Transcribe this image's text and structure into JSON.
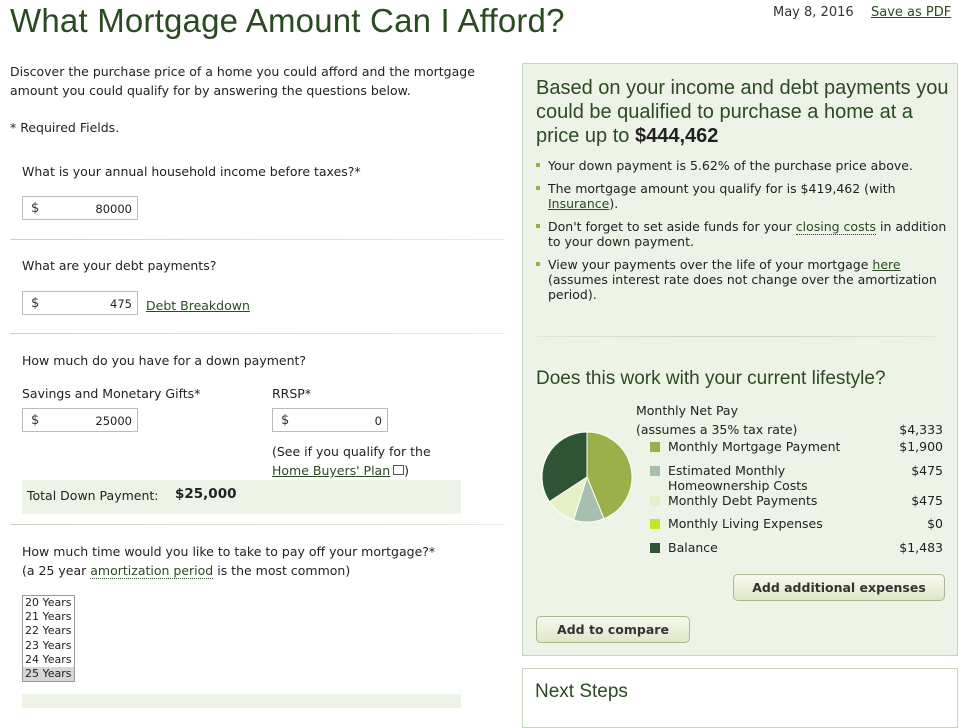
{
  "page": {
    "title": "What Mortgage Amount Can I Afford?",
    "date": "May 8, 2016",
    "save_pdf": "Save as PDF"
  },
  "intro": {
    "text": "Discover the purchase price of a home you could afford and the mortgage amount you could qualify for by answering the questions below.",
    "required_note": "* Required Fields."
  },
  "income": {
    "label": "What is your annual household income before taxes?*",
    "currency": "$",
    "value": "80000"
  },
  "debt": {
    "label": "What are your debt payments?",
    "currency": "$",
    "value": "475",
    "breakdown_link": "Debt Breakdown"
  },
  "down_payment": {
    "label": "How much do you have for a down payment?",
    "savings_label": "Savings and Monetary Gifts*",
    "savings_currency": "$",
    "savings_value": "25000",
    "rrsp_label": "RRSP*",
    "rrsp_currency": "$",
    "rrsp_value": "0",
    "hbp_prefix": "(See if you qualify for the",
    "hbp_link": "Home Buyers' Plan",
    "hbp_suffix": ")",
    "total_label": "Total Down Payment:",
    "total_value": "$25,000"
  },
  "amortization": {
    "label": "How much time would you like to take to pay off your mortgage?*",
    "note_prefix": "(a 25 year",
    "note_link": "amortization period",
    "note_suffix": "is the most common)",
    "options": [
      "20 Years",
      "21 Years",
      "22 Years",
      "23 Years",
      "24 Years",
      "25 Years"
    ],
    "selected": "25 Years"
  },
  "results": {
    "headline": "Based on your income and debt payments you could be qualified to purchase a home at a price up to",
    "price": "$444,462",
    "bullet1": "Your down payment is 5.62% of the purchase price above.",
    "bullet2_prefix": "The mortgage amount you qualify for is $419,462 (with",
    "bullet2_link": "Insurance",
    "bullet2_suffix": ").",
    "bullet3_prefix": "Don't forget to set aside funds for your",
    "bullet3_link": "closing costs",
    "bullet3_suffix": "in addition to your down payment.",
    "bullet4_prefix": "View your payments over the life of your mortgage",
    "bullet4_link": "here",
    "bullet4_suffix": "(assumes interest rate does not change over the amortization period)."
  },
  "lifestyle": {
    "heading": "Does this work with your current lifestyle?",
    "net_pay_label": "Monthly Net Pay",
    "net_pay_note": "(assumes a 35% tax rate)",
    "net_pay_value": "$4,333",
    "items": [
      {
        "label": "Monthly Mortgage Payment",
        "value": "$1,900",
        "color": "#9bb04a",
        "amount": 1900
      },
      {
        "label": "Estimated Monthly Homeownership Costs",
        "value": "$475",
        "color": "#a7bfae",
        "amount": 475
      },
      {
        "label": "Monthly Debt Payments",
        "value": "$475",
        "color": "#e5f0c8",
        "amount": 475
      },
      {
        "label": "Monthly Living Expenses",
        "value": "$0",
        "color": "#c5e62c",
        "amount": 0
      },
      {
        "label": "Balance",
        "value": "$1,483",
        "color": "#2e5434",
        "amount": 1483
      }
    ],
    "add_expenses": "Add additional expenses",
    "add_compare": "Add to compare"
  },
  "next_steps": {
    "heading": "Next Steps"
  }
}
